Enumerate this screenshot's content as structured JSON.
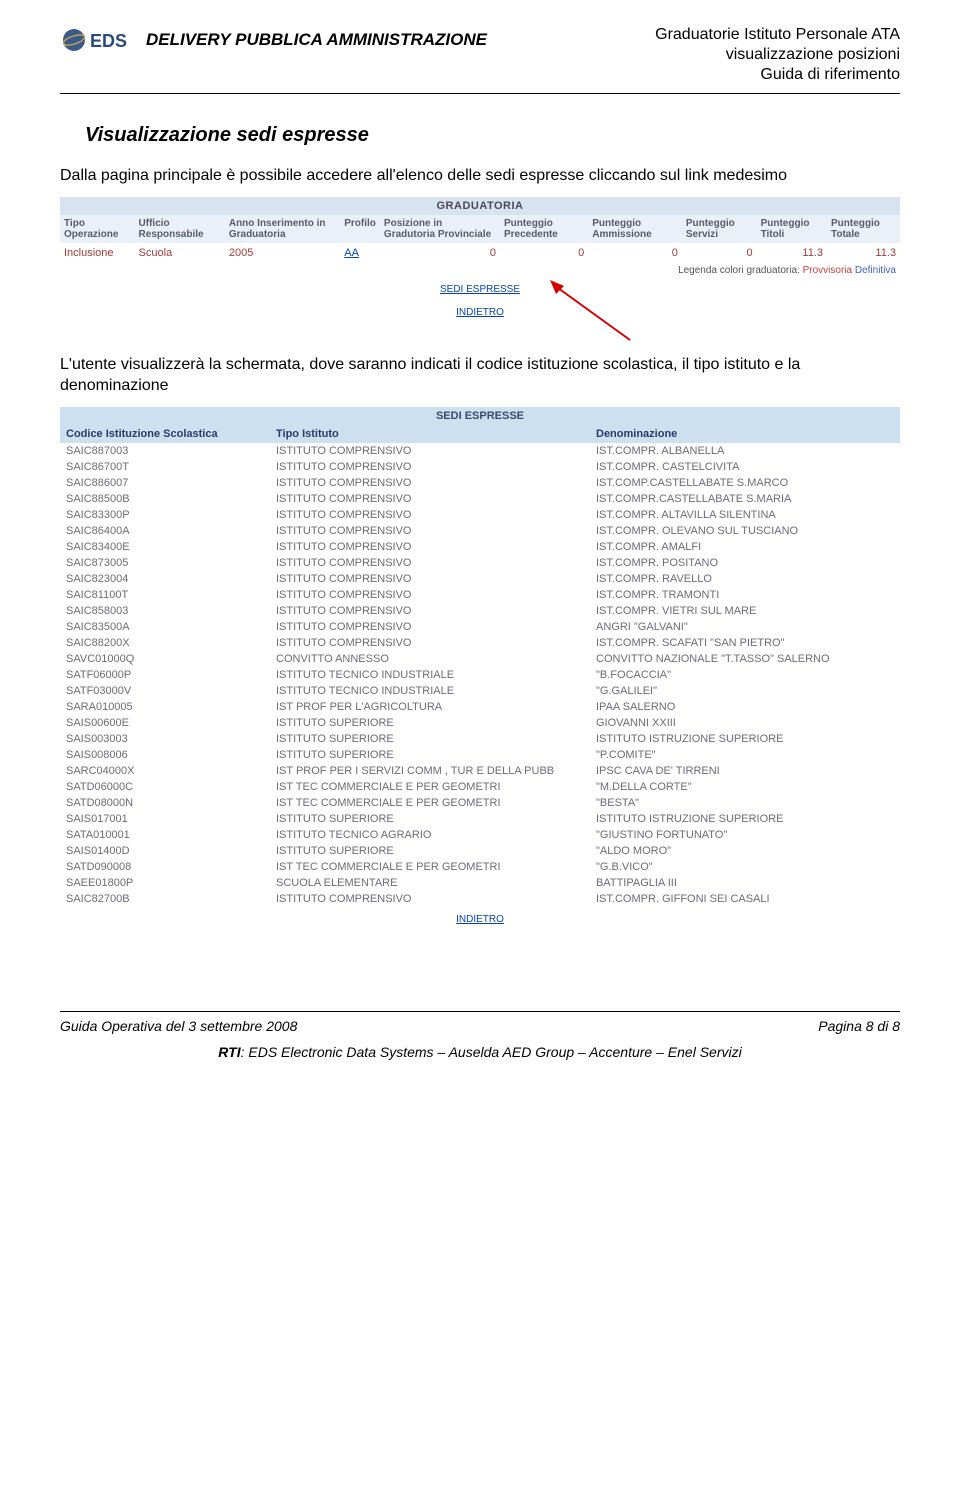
{
  "header": {
    "left_title": "DELIVERY PUBBLICA AMMINISTRAZIONE",
    "right_line1": "Graduatorie Istituto Personale ATA",
    "right_line2": "visualizzazione posizioni",
    "right_line3": "Guida di riferimento",
    "logo_text": "EDS"
  },
  "section": {
    "title": "Visualizzazione sedi espresse",
    "para1": "Dalla pagina principale è possibile accedere all'elenco delle sedi espresse cliccando sul link medesimo",
    "para2": "L'utente visualizzerà la schermata, dove saranno indicati il codice istituzione scolastica, il tipo istituto e la denominazione"
  },
  "grad": {
    "title": "GRADUATORIA",
    "headers": {
      "tipo_operazione": "Tipo Operazione",
      "ufficio_resp": "Ufficio Responsabile",
      "anno_ins": "Anno Inserimento in Graduatoria",
      "profilo": "Profilo",
      "posizione": "Posizione in Gradutoria Provinciale",
      "punt_prec": "Punteggio Precedente",
      "punt_amm": "Punteggio Ammissione",
      "punt_serv": "Punteggio Servizi",
      "punt_tit": "Punteggio Titoli",
      "punt_tot": "Punteggio Totale"
    },
    "row": {
      "tipo_operazione": "Inclusione",
      "ufficio_resp": "Scuola",
      "anno_ins": "2005",
      "profilo": "AA",
      "posizione": "0",
      "punt_prec": "0",
      "punt_amm": "0",
      "punt_serv": "0",
      "punt_tit": "11.3",
      "punt_tot": "11.3"
    },
    "legend_label": "Legenda colori graduatoria:",
    "legend_prov": "Provvisoria",
    "legend_def": "Definitiva",
    "link_sedi": "SEDI ESPRESSE",
    "link_back": "INDIETRO"
  },
  "sedi": {
    "title": "SEDI ESPRESSE",
    "headers": {
      "codice": "Codice Istituzione Scolastica",
      "tipo": "Tipo Istituto",
      "denom": "Denominazione"
    },
    "rows": [
      {
        "codice": "SAIC887003",
        "tipo": "ISTITUTO COMPRENSIVO",
        "denom": "IST.COMPR. ALBANELLA"
      },
      {
        "codice": "SAIC86700T",
        "tipo": "ISTITUTO COMPRENSIVO",
        "denom": "IST.COMPR. CASTELCIVITA"
      },
      {
        "codice": "SAIC886007",
        "tipo": "ISTITUTO COMPRENSIVO",
        "denom": "IST.COMP.CASTELLABATE S.MARCO"
      },
      {
        "codice": "SAIC88500B",
        "tipo": "ISTITUTO COMPRENSIVO",
        "denom": "IST.COMPR.CASTELLABATE S.MARIA"
      },
      {
        "codice": "SAIC83300P",
        "tipo": "ISTITUTO COMPRENSIVO",
        "denom": "IST.COMPR. ALTAVILLA SILENTINA"
      },
      {
        "codice": "SAIC86400A",
        "tipo": "ISTITUTO COMPRENSIVO",
        "denom": "IST.COMPR. OLEVANO SUL TUSCIANO"
      },
      {
        "codice": "SAIC83400E",
        "tipo": "ISTITUTO COMPRENSIVO",
        "denom": "IST.COMPR. AMALFI"
      },
      {
        "codice": "SAIC873005",
        "tipo": "ISTITUTO COMPRENSIVO",
        "denom": "IST.COMPR. POSITANO"
      },
      {
        "codice": "SAIC823004",
        "tipo": "ISTITUTO COMPRENSIVO",
        "denom": "IST.COMPR. RAVELLO"
      },
      {
        "codice": "SAIC81100T",
        "tipo": "ISTITUTO COMPRENSIVO",
        "denom": "IST.COMPR. TRAMONTI"
      },
      {
        "codice": "SAIC858003",
        "tipo": "ISTITUTO COMPRENSIVO",
        "denom": "IST.COMPR. VIETRI SUL MARE"
      },
      {
        "codice": "SAIC83500A",
        "tipo": "ISTITUTO COMPRENSIVO",
        "denom": "ANGRI \"GALVANI\""
      },
      {
        "codice": "SAIC88200X",
        "tipo": "ISTITUTO COMPRENSIVO",
        "denom": "IST.COMPR. SCAFATI \"SAN PIETRO\""
      },
      {
        "codice": "SAVC01000Q",
        "tipo": "CONVITTO ANNESSO",
        "denom": "CONVITTO NAZIONALE \"T.TASSO\" SALERNO"
      },
      {
        "codice": "SATF06000P",
        "tipo": "ISTITUTO TECNICO INDUSTRIALE",
        "denom": "\"B.FOCACCIA\""
      },
      {
        "codice": "SATF03000V",
        "tipo": "ISTITUTO TECNICO INDUSTRIALE",
        "denom": "\"G.GALILEI\""
      },
      {
        "codice": "SARA010005",
        "tipo": "IST PROF PER L'AGRICOLTURA",
        "denom": "IPAA SALERNO"
      },
      {
        "codice": "SAIS00600E",
        "tipo": "ISTITUTO SUPERIORE",
        "denom": "GIOVANNI XXIII"
      },
      {
        "codice": "SAIS003003",
        "tipo": "ISTITUTO SUPERIORE",
        "denom": "ISTITUTO ISTRUZIONE SUPERIORE"
      },
      {
        "codice": "SAIS008006",
        "tipo": "ISTITUTO SUPERIORE",
        "denom": "\"P.COMITE\""
      },
      {
        "codice": "SARC04000X",
        "tipo": "IST PROF PER I SERVIZI COMM , TUR E DELLA PUBB",
        "denom": "IPSC CAVA DE' TIRRENI"
      },
      {
        "codice": "SATD06000C",
        "tipo": "IST TEC COMMERCIALE E PER GEOMETRI",
        "denom": "\"M.DELLA CORTE\""
      },
      {
        "codice": "SATD08000N",
        "tipo": "IST TEC COMMERCIALE E PER GEOMETRI",
        "denom": "\"BESTA\""
      },
      {
        "codice": "SAIS017001",
        "tipo": "ISTITUTO SUPERIORE",
        "denom": "ISTITUTO ISTRUZIONE SUPERIORE"
      },
      {
        "codice": "SATA010001",
        "tipo": "ISTITUTO TECNICO AGRARIO",
        "denom": "\"GIUSTINO FORTUNATO\""
      },
      {
        "codice": "SAIS01400D",
        "tipo": "ISTITUTO SUPERIORE",
        "denom": "\"ALDO MORO\""
      },
      {
        "codice": "SATD090008",
        "tipo": "IST TEC COMMERCIALE E PER GEOMETRI",
        "denom": "\"G.B.VICO\""
      },
      {
        "codice": "SAEE01800P",
        "tipo": "SCUOLA ELEMENTARE",
        "denom": "BATTIPAGLIA III"
      },
      {
        "codice": "SAIC82700B",
        "tipo": "ISTITUTO COMPRENSIVO",
        "denom": "IST.COMPR. GIFFONI SEI CASALI"
      }
    ],
    "link_back": "INDIETRO"
  },
  "footer": {
    "guide": "Guida Operativa del 3 settembre 2008",
    "page": "Pagina 8 di 8",
    "rti_prefix": "RTI",
    "rti_text": ": EDS Electronic Data Systems – Auselda AED Group – Accenture – Enel Servizi"
  }
}
